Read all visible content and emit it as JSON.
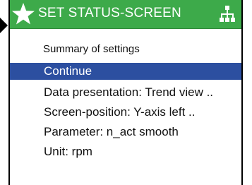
{
  "header": {
    "title": "SET STATUS-SCREEN",
    "star_icon": "star-icon",
    "network_icon": "network-icon",
    "color": "#3daa4a"
  },
  "summary_label": "Summary of settings",
  "menu": {
    "selected_color": "#2c4fa0",
    "items": [
      {
        "label": "Continue",
        "selected": true
      },
      {
        "label": "Data presentation: Trend view ..",
        "selected": false
      },
      {
        "label": "Screen-position: Y-axis left ..",
        "selected": false
      },
      {
        "label": "Parameter: n_act smooth",
        "selected": false
      },
      {
        "label": "Unit: rpm",
        "selected": false
      }
    ]
  }
}
